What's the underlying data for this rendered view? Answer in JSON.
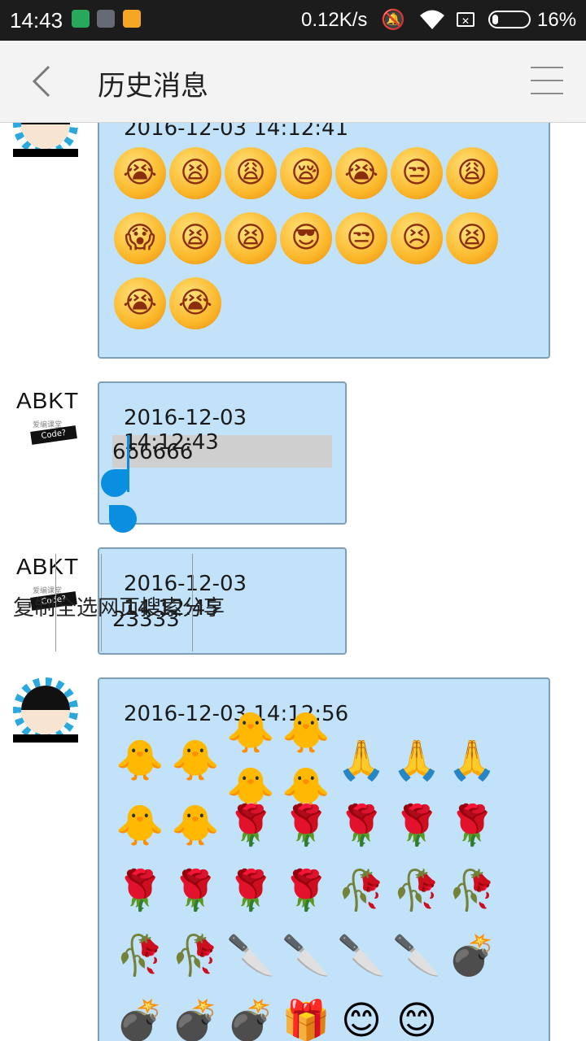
{
  "status_bar": {
    "time": "14:43",
    "speed": "0.12K/s",
    "battery_level": "16%",
    "battery_fraction": 0.16,
    "icons": [
      "shield-icon",
      "cat-icon",
      "folder-icon",
      "mute-icon",
      "wifi-icon",
      "no-sim-icon",
      "battery-icon"
    ]
  },
  "titlebar": {
    "title": "历史消息",
    "back_icon": "chevron-left-icon",
    "menu_icon": "hamburger-menu-icon"
  },
  "messages": [
    {
      "avatar": "girl",
      "timestamp": "2016-12-03 14:12:41",
      "type": "emoji",
      "emoji": [
        "😭",
        "😫",
        "😩",
        "😪",
        "😭",
        "😒",
        "😩",
        "😱",
        "😫",
        "😫",
        "😎",
        "😒",
        "😣",
        "😫",
        "😭",
        "😭"
      ]
    },
    {
      "avatar": "abkt",
      "timestamp": "2016-12-03 14:12:43",
      "type": "text",
      "text": "666666",
      "selected": true
    },
    {
      "avatar": "abkt",
      "timestamp": "2016-12-03 14:12:45",
      "type": "text",
      "text": "23333"
    },
    {
      "avatar": "girl",
      "timestamp": "2016-12-03 14:12:56",
      "type": "emoji",
      "emoji": [
        "🐥",
        "🐥",
        "🐥🐥",
        "🐥🐥",
        "🙏",
        "🙏",
        "🙏",
        "🐥",
        "🐥",
        "🌹",
        "🌹",
        "🌹",
        "🌹",
        "🌹",
        "🌹",
        "🌹",
        "🌹",
        "🌹",
        "🥀",
        "🥀",
        "🥀",
        "🥀",
        "🥀",
        "🔪",
        "🔪",
        "🔪",
        "🔪",
        "💣",
        "💣",
        "💣",
        "💣",
        "🎁",
        "😊",
        "😊"
      ]
    }
  ],
  "avatar_abkt": {
    "brand": "ABKT",
    "sub": "爱编课堂",
    "band": "Code?"
  },
  "context_menu": {
    "items": [
      "复制",
      "全选",
      "网页搜索",
      "分享"
    ]
  },
  "colors": {
    "bubble": "#c2e2fa",
    "bubble_border": "#7da0b8",
    "accent": "#0a8fe0",
    "statusbar": "#1c1c1c",
    "titlebar": "#f3f3f3"
  }
}
